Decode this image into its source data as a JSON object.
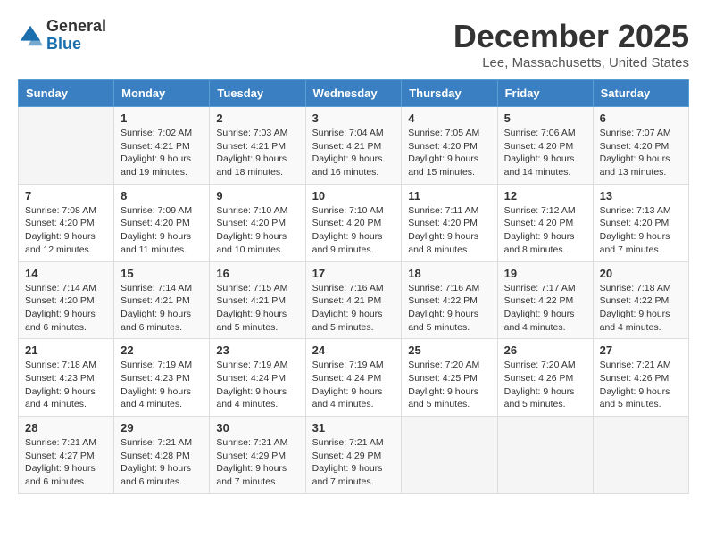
{
  "logo": {
    "general": "General",
    "blue": "Blue"
  },
  "title": {
    "month": "December 2025",
    "location": "Lee, Massachusetts, United States"
  },
  "days_header": [
    "Sunday",
    "Monday",
    "Tuesday",
    "Wednesday",
    "Thursday",
    "Friday",
    "Saturday"
  ],
  "weeks": [
    [
      {
        "day": "",
        "info": ""
      },
      {
        "day": "1",
        "info": "Sunrise: 7:02 AM\nSunset: 4:21 PM\nDaylight: 9 hours\nand 19 minutes."
      },
      {
        "day": "2",
        "info": "Sunrise: 7:03 AM\nSunset: 4:21 PM\nDaylight: 9 hours\nand 18 minutes."
      },
      {
        "day": "3",
        "info": "Sunrise: 7:04 AM\nSunset: 4:21 PM\nDaylight: 9 hours\nand 16 minutes."
      },
      {
        "day": "4",
        "info": "Sunrise: 7:05 AM\nSunset: 4:20 PM\nDaylight: 9 hours\nand 15 minutes."
      },
      {
        "day": "5",
        "info": "Sunrise: 7:06 AM\nSunset: 4:20 PM\nDaylight: 9 hours\nand 14 minutes."
      },
      {
        "day": "6",
        "info": "Sunrise: 7:07 AM\nSunset: 4:20 PM\nDaylight: 9 hours\nand 13 minutes."
      }
    ],
    [
      {
        "day": "7",
        "info": "Sunrise: 7:08 AM\nSunset: 4:20 PM\nDaylight: 9 hours\nand 12 minutes."
      },
      {
        "day": "8",
        "info": "Sunrise: 7:09 AM\nSunset: 4:20 PM\nDaylight: 9 hours\nand 11 minutes."
      },
      {
        "day": "9",
        "info": "Sunrise: 7:10 AM\nSunset: 4:20 PM\nDaylight: 9 hours\nand 10 minutes."
      },
      {
        "day": "10",
        "info": "Sunrise: 7:10 AM\nSunset: 4:20 PM\nDaylight: 9 hours\nand 9 minutes."
      },
      {
        "day": "11",
        "info": "Sunrise: 7:11 AM\nSunset: 4:20 PM\nDaylight: 9 hours\nand 8 minutes."
      },
      {
        "day": "12",
        "info": "Sunrise: 7:12 AM\nSunset: 4:20 PM\nDaylight: 9 hours\nand 8 minutes."
      },
      {
        "day": "13",
        "info": "Sunrise: 7:13 AM\nSunset: 4:20 PM\nDaylight: 9 hours\nand 7 minutes."
      }
    ],
    [
      {
        "day": "14",
        "info": "Sunrise: 7:14 AM\nSunset: 4:20 PM\nDaylight: 9 hours\nand 6 minutes."
      },
      {
        "day": "15",
        "info": "Sunrise: 7:14 AM\nSunset: 4:21 PM\nDaylight: 9 hours\nand 6 minutes."
      },
      {
        "day": "16",
        "info": "Sunrise: 7:15 AM\nSunset: 4:21 PM\nDaylight: 9 hours\nand 5 minutes."
      },
      {
        "day": "17",
        "info": "Sunrise: 7:16 AM\nSunset: 4:21 PM\nDaylight: 9 hours\nand 5 minutes."
      },
      {
        "day": "18",
        "info": "Sunrise: 7:16 AM\nSunset: 4:22 PM\nDaylight: 9 hours\nand 5 minutes."
      },
      {
        "day": "19",
        "info": "Sunrise: 7:17 AM\nSunset: 4:22 PM\nDaylight: 9 hours\nand 4 minutes."
      },
      {
        "day": "20",
        "info": "Sunrise: 7:18 AM\nSunset: 4:22 PM\nDaylight: 9 hours\nand 4 minutes."
      }
    ],
    [
      {
        "day": "21",
        "info": "Sunrise: 7:18 AM\nSunset: 4:23 PM\nDaylight: 9 hours\nand 4 minutes."
      },
      {
        "day": "22",
        "info": "Sunrise: 7:19 AM\nSunset: 4:23 PM\nDaylight: 9 hours\nand 4 minutes."
      },
      {
        "day": "23",
        "info": "Sunrise: 7:19 AM\nSunset: 4:24 PM\nDaylight: 9 hours\nand 4 minutes."
      },
      {
        "day": "24",
        "info": "Sunrise: 7:19 AM\nSunset: 4:24 PM\nDaylight: 9 hours\nand 4 minutes."
      },
      {
        "day": "25",
        "info": "Sunrise: 7:20 AM\nSunset: 4:25 PM\nDaylight: 9 hours\nand 5 minutes."
      },
      {
        "day": "26",
        "info": "Sunrise: 7:20 AM\nSunset: 4:26 PM\nDaylight: 9 hours\nand 5 minutes."
      },
      {
        "day": "27",
        "info": "Sunrise: 7:21 AM\nSunset: 4:26 PM\nDaylight: 9 hours\nand 5 minutes."
      }
    ],
    [
      {
        "day": "28",
        "info": "Sunrise: 7:21 AM\nSunset: 4:27 PM\nDaylight: 9 hours\nand 6 minutes."
      },
      {
        "day": "29",
        "info": "Sunrise: 7:21 AM\nSunset: 4:28 PM\nDaylight: 9 hours\nand 6 minutes."
      },
      {
        "day": "30",
        "info": "Sunrise: 7:21 AM\nSunset: 4:29 PM\nDaylight: 9 hours\nand 7 minutes."
      },
      {
        "day": "31",
        "info": "Sunrise: 7:21 AM\nSunset: 4:29 PM\nDaylight: 9 hours\nand 7 minutes."
      },
      {
        "day": "",
        "info": ""
      },
      {
        "day": "",
        "info": ""
      },
      {
        "day": "",
        "info": ""
      }
    ]
  ]
}
